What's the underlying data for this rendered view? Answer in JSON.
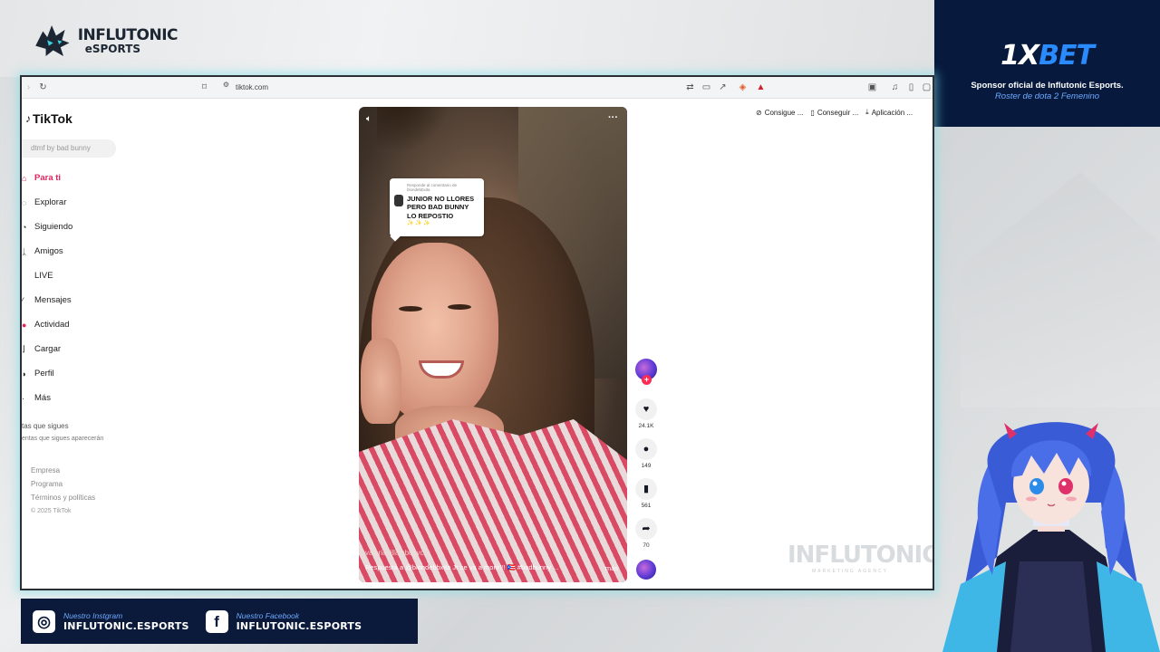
{
  "branding": {
    "name": "INFLUTONIC",
    "sub": "eSPORTS"
  },
  "sponsor": {
    "logo_part1": "1X",
    "logo_part2": "BET",
    "line": "Sponsor oficial de Influtonic Esports.",
    "subline": "Roster de dota 2 Femenino"
  },
  "browser": {
    "url": "tiktok.com",
    "icons": [
      "reload-icon",
      "bookmark-icon",
      "site-info-icon",
      "translate-icon",
      "cast-icon",
      "share-icon",
      "shield-extension-icon",
      "alert-extension-icon",
      "tab-icon",
      "music-icon",
      "sidebar-icon",
      "window-icon"
    ]
  },
  "tiktok": {
    "logo": "TikTok",
    "search_placeholder": "dtmf by bad bunny",
    "nav": [
      {
        "label": "Para ti",
        "icon": "home-icon",
        "active": true
      },
      {
        "label": "Explorar",
        "icon": "compass-icon"
      },
      {
        "label": "Siguiendo",
        "icon": "following-icon"
      },
      {
        "label": "Amigos",
        "icon": "friends-icon"
      },
      {
        "label": "LIVE",
        "icon": "live-icon"
      },
      {
        "label": "Mensajes",
        "icon": "messages-icon"
      },
      {
        "label": "Actividad",
        "icon": "activity-icon"
      },
      {
        "label": "Cargar",
        "icon": "upload-icon"
      },
      {
        "label": "Perfil",
        "icon": "profile-icon"
      },
      {
        "label": "Más",
        "icon": "more-icon"
      }
    ],
    "following_header": "tas que sigues",
    "following_sub": "entas que sigues aparecerán",
    "footer": {
      "links": [
        "Empresa",
        "Programa",
        "Términos y políticas"
      ],
      "copyright": "© 2025 TikTok"
    },
    "top_actions": [
      {
        "label": "Consigue ...",
        "icon": "coin-icon"
      },
      {
        "label": "Conseguir ...",
        "icon": "phone-icon"
      },
      {
        "label": "Aplicación ...",
        "icon": "download-icon"
      }
    ],
    "video": {
      "reply_header": "Responde al comentario de blondebbxita",
      "reply_text": "JUNIOR NO LLORES PERO BAD BUNNY LO REPOSTIO",
      "reply_emoji": "✨ ✨ ✨",
      "username": "valeriavillalobosvc",
      "caption": "Respuesta a @blondebbxita Jr se va a morir!!! 🇵🇷 #badbunny ...",
      "more": "más"
    },
    "actions": {
      "likes": "24.1K",
      "comments": "149",
      "saves": "561",
      "shares": "70"
    }
  },
  "watermark": {
    "text": "INFLUTONIC",
    "sub": "MARKETING AGENCY"
  },
  "social": {
    "instagram_label": "Nuestro Instgram",
    "instagram_handle": "INFLUTONIC.ESPORTS",
    "facebook_label": "Nuestro Facebook",
    "facebook_handle": "INFLUTONIC.ESPORTS"
  },
  "colors": {
    "tiktok_accent": "#e0245e",
    "sponsor_bg": "#071a3d",
    "social_bg": "#0b1a3a",
    "frame_glow": "#78dce6"
  }
}
